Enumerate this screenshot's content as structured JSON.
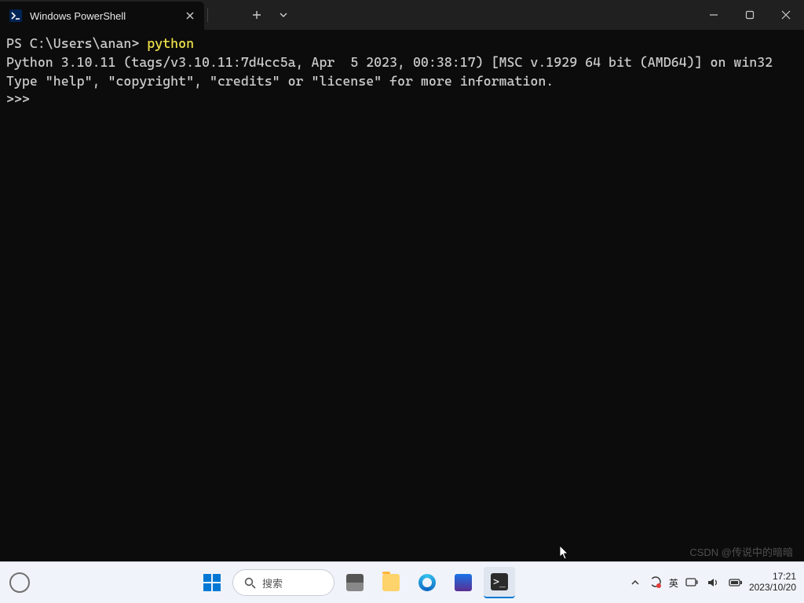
{
  "titlebar": {
    "tab_title": "Windows PowerShell",
    "tab_icon_label": ">_"
  },
  "terminal": {
    "prompt_prefix": "PS C:\\Users\\anan> ",
    "command": "python",
    "line1": "Python 3.10.11 (tags/v3.10.11:7d4cc5a, Apr  5 2023, 00:38:17) [MSC v.1929 64 bit (AMD64)] on win32",
    "line2": "Type \"help\", \"copyright\", \"credits\" or \"license\" for more information.",
    "repl_prompt": ">>> "
  },
  "taskbar": {
    "search_placeholder": "搜索",
    "ime_label": "英",
    "time": "17:21",
    "date": "2023/10/20"
  },
  "watermark": "CSDN @传说中的暗暗"
}
